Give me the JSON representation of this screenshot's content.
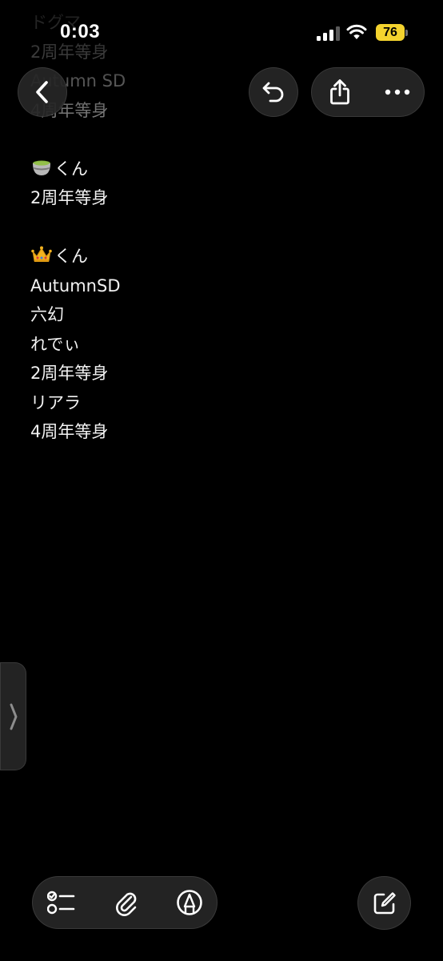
{
  "status_bar": {
    "time": "0:03",
    "battery": "76",
    "icons": [
      "cellular-signal-icon",
      "wifi-icon",
      "battery-icon"
    ]
  },
  "nav": {
    "icons": [
      "chevron-left-icon",
      "undo-icon",
      "share-icon",
      "ellipsis-icon"
    ]
  },
  "note": {
    "lines": [
      {
        "text": "ドグマ",
        "faded": true
      },
      {
        "text": "2周年等身",
        "faded": true
      },
      {
        "text": "Autumn SD",
        "faded": true
      },
      {
        "text": "4周年等身",
        "faded": true
      },
      {
        "text": ""
      },
      {
        "emoji": "tea-emoji",
        "text": "くん"
      },
      {
        "text": "2周年等身"
      },
      {
        "text": ""
      },
      {
        "emoji": "crown-emoji",
        "text": "くん"
      },
      {
        "text": "AutumnSD"
      },
      {
        "text": "六幻"
      },
      {
        "text": "れでぃ"
      },
      {
        "text": "2周年等身"
      },
      {
        "text": "リアラ"
      },
      {
        "text": "4周年等身"
      }
    ]
  },
  "toolbar": {
    "icons": [
      "checklist-icon",
      "paperclip-icon",
      "markup-pen-icon",
      "compose-icon"
    ]
  },
  "side_handle": {
    "icon": "chevron-right-icon"
  },
  "colors": {
    "background": "#000000",
    "text": "#f2f2f2",
    "battery": "#f4d32e",
    "button_bg": "#262626"
  }
}
